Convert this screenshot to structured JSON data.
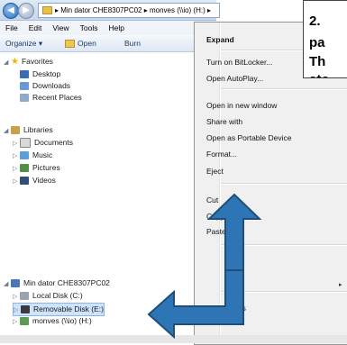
{
  "window": {
    "address_path": "▸ Min dator CHE8307PC02 ▸ monves (\\\\io) (H:) ▸"
  },
  "menubar": {
    "items": [
      "File",
      "Edit",
      "View",
      "Tools",
      "Help"
    ]
  },
  "commandbar": {
    "organize": "Organize ▾",
    "open": "Open",
    "burn": "Burn"
  },
  "navpane": {
    "favorites": "Favorites",
    "desktop": "Desktop",
    "downloads": "Downloads",
    "recent": "Recent Places",
    "libraries": "Libraries",
    "documents": "Documents",
    "music": "Music",
    "pictures": "Pictures",
    "videos": "Videos",
    "computer": "Min dator CHE8307PC02",
    "local_disk": "Local Disk (C:)",
    "removable": "Removable Disk (E:)",
    "network_drive": "monves (\\\\io) (H:)"
  },
  "context_menu": {
    "expand": "Expand",
    "bitlocker": "Turn on BitLocker...",
    "autoplay": "Open AutoPlay...",
    "new_window": "Open in new window",
    "share_with": "Share with",
    "portable": "Open as Portable Device",
    "format": "Format...",
    "eject": "Eject",
    "cut": "Cut",
    "copy": "Copy",
    "paste": "Paste",
    "properties_partial": "ies"
  },
  "callout": {
    "line1": "2.",
    "line2": "pa",
    "line3": "Th",
    "line4": "sto"
  },
  "colors": {
    "arrow_fill": "#2e75b6",
    "arrow_stroke": "#1f4e79"
  }
}
